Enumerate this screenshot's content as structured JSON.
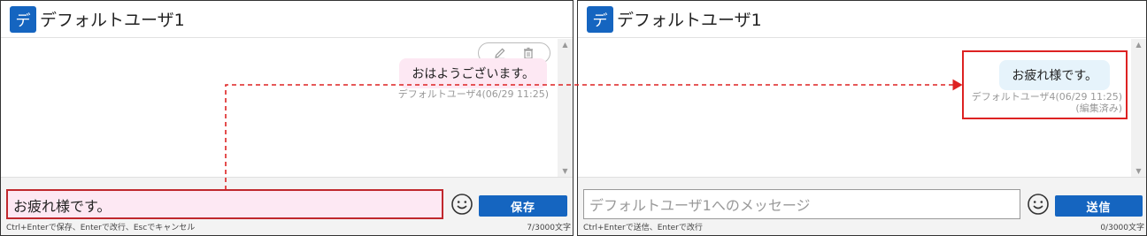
{
  "left": {
    "header": {
      "avatar_char": "デ",
      "title": "デフォルトユーザ1"
    },
    "message": {
      "text": "おはようございます。",
      "meta": "デフォルトユーザ4(06/29 11:25)"
    },
    "input": {
      "value": "お疲れ様です。"
    },
    "buttons": {
      "save_label": "保存"
    },
    "hint": "Ctrl+Enterで保存、Enterで改行、Escでキャンセル",
    "counter": "7/3000文字"
  },
  "right": {
    "header": {
      "avatar_char": "デ",
      "title": "デフォルトユーザ1"
    },
    "message": {
      "text": "お疲れ様です。",
      "meta": "デフォルトユーザ4(06/29 11:25)",
      "edited": "(編集済み)"
    },
    "input": {
      "placeholder": "デフォルトユーザ1へのメッセージ"
    },
    "buttons": {
      "send_label": "送信"
    },
    "hint": "Ctrl+Enterで送信、Enterで改行",
    "counter": "0/3000文字"
  },
  "colors": {
    "accent": "#1565c0",
    "editing_bubble": "#fde8f3",
    "sent_bubble": "#e6f3fb",
    "highlight": "#d22222"
  }
}
